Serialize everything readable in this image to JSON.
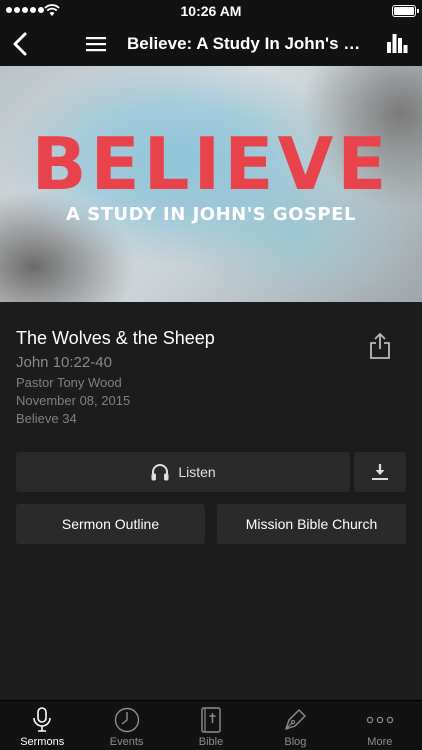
{
  "status_bar": {
    "time": "10:26 AM"
  },
  "nav": {
    "title": "Believe: A Study In John's Gospel"
  },
  "banner": {
    "title": "BELIEVE",
    "subtitle": "A STUDY IN JOHN'S GOSPEL"
  },
  "sermon": {
    "title": "The Wolves & the Sheep",
    "scripture": "John 10:22-40",
    "pastor": "Pastor Tony Wood",
    "date": "November 08, 2015",
    "series": "Believe 34"
  },
  "actions": {
    "listen_label": "Listen",
    "outline_label": "Sermon Outline",
    "church_label": "Mission Bible Church"
  },
  "tabs": [
    {
      "label": "Sermons",
      "icon": "microphone-icon",
      "active": true
    },
    {
      "label": "Events",
      "icon": "clock-icon",
      "active": false
    },
    {
      "label": "Bible",
      "icon": "bible-icon",
      "active": false
    },
    {
      "label": "Blog",
      "icon": "pen-icon",
      "active": false
    },
    {
      "label": "More",
      "icon": "more-dots-icon",
      "active": false
    }
  ]
}
